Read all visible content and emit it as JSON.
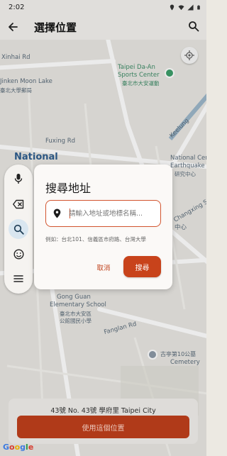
{
  "status_bar": {
    "time": "2:02"
  },
  "app_bar": {
    "title": "選擇位置"
  },
  "map": {
    "labels": {
      "xinhai": "Xinhai Rd",
      "moonlake": "Jinken Moon Lake",
      "moonlake_zh": "臺北大學郵局",
      "daan_center_en": "Taipei Da-An",
      "daan_center_en2": "Sports Center",
      "daan_center_zh": "臺北市大安運動",
      "fuxing": "Fuxing Rd",
      "national": "National",
      "keelung": "Keelung",
      "national_center": "National Center for",
      "national_center2": "Earthquake Enginee",
      "national_center_zh": "研究中心",
      "changxing": "Changxing St",
      "zhongxin": "中心",
      "gongguan_en": "Gong Guan",
      "gongguan_en2": "Elementary School",
      "gongguan_zh": "臺北市大安區",
      "gongguan_zh2": "公館國民小學",
      "fanglan": "Fanglan Rd",
      "cemetery_zh": "古亭第10公墓",
      "cemetery_en": "Cemetery"
    }
  },
  "bottom_card": {
    "address": "43號 No. 43號 學府里 Taipei City",
    "use_location_label": "使用這個位置"
  },
  "google_logo": [
    "G",
    "o",
    "o",
    "g",
    "l",
    "e"
  ],
  "dialog": {
    "title": "搜尋地址",
    "placeholder": "請輸入地址或地標名稱...",
    "example": "例如：台北101、信義區市府路、台灣大學",
    "cancel_label": "取消",
    "search_label": "搜尋"
  },
  "keyboard_toolbar": {
    "icons": [
      "mic-icon",
      "backspace-icon",
      "search-icon",
      "emoji-icon",
      "menu-icon"
    ]
  },
  "colors": {
    "accent": "#c8431b",
    "use_location_bg": "#bf3f1c",
    "field_border": "#d2542e",
    "map_bg": "#e9e7e2"
  }
}
